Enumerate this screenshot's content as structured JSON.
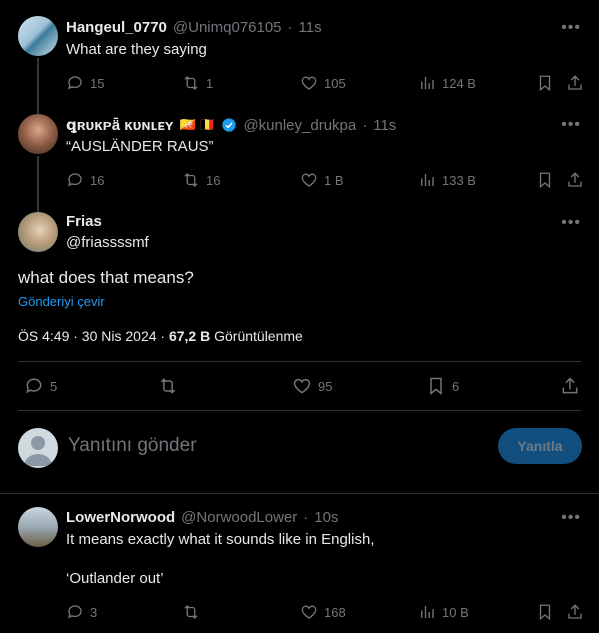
{
  "tweets": [
    {
      "name": "Hangeul_0770",
      "handle": "@Unimq076105",
      "time": "11s",
      "text": "What are they saying",
      "reply_count": "15",
      "retweet_count": "1",
      "like_count": "105",
      "view_count": "124 B"
    },
    {
      "name": "ꝗʀᴜĸᴘǟ ĸᴜɴʟᴇʏ",
      "flags": "🇧🇹 🇧🇪",
      "handle": "@kunley_drukpa",
      "time": "11s",
      "text": "“AUSLÄNDER RAUS”",
      "reply_count": "16",
      "retweet_count": "16",
      "like_count": "1 B",
      "view_count": "133 B"
    }
  ],
  "main": {
    "name": "Frias",
    "handle": "@friassssmf",
    "text": "what does that means?",
    "translate": "Gönderiyi çevir",
    "timestamp": "ÖS 4:49 · 30 Nis 2024 · ",
    "views_count": "67,2 B",
    "views_label": " Görüntülenme",
    "reply_count": "5",
    "retweet_count": "",
    "like_count": "95",
    "bookmark_count": "6"
  },
  "compose": {
    "placeholder": "Yanıtını gönder",
    "button": "Yanıtla"
  },
  "reply": {
    "name": "LowerNorwood",
    "handle": "@NorwoodLower",
    "time": "10s",
    "text_line1": "It means exactly what it sounds like in English,",
    "text_line2": "‘Outlander out’",
    "reply_count": "3",
    "like_count": "168",
    "view_count": "10 B"
  },
  "colors": {
    "background": "#000000",
    "text": "#e7e9ea",
    "muted": "#71767b",
    "link": "#1d9bf0",
    "divider": "#2f3336",
    "verified": "#1d9bf0"
  }
}
